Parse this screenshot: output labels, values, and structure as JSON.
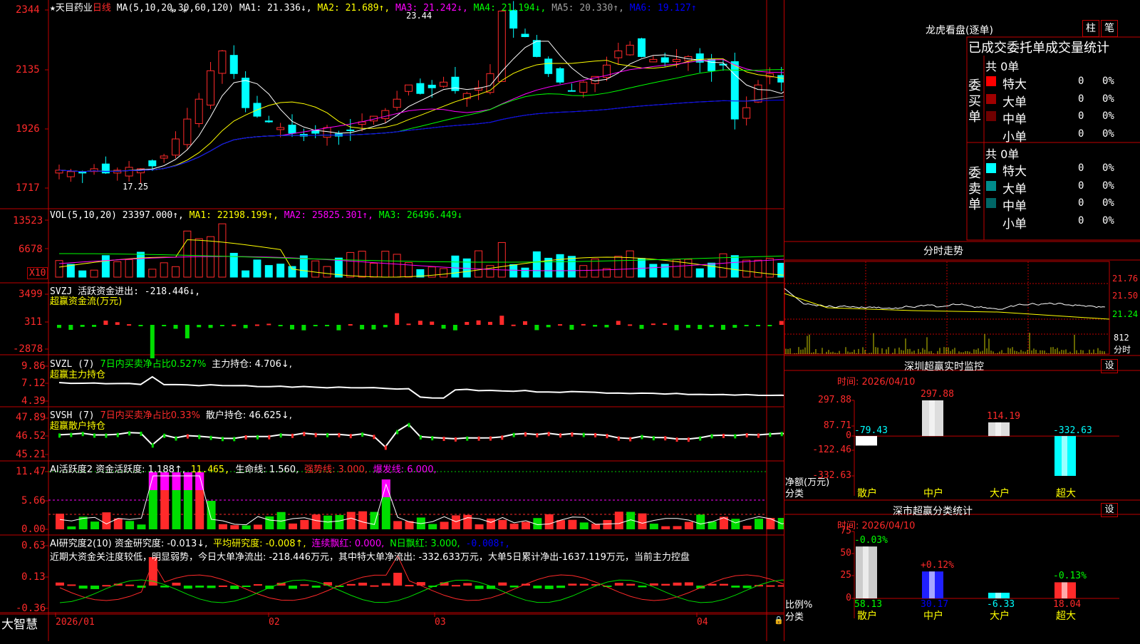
{
  "colors": {
    "up": "#ff2a2a",
    "down": "#00ffff",
    "axis": "#c00000",
    "ma1": "#ffffff",
    "ma2": "#ffff00",
    "ma3": "#ff00ff",
    "ma4": "#00ff00",
    "ma5": "#a0a0a0",
    "ma6": "#0000ff"
  },
  "main_chart": {
    "star": "★",
    "stock_name": "天目药业",
    "period": "日线",
    "ma_params": "MA(5,10,20,30,60,120)",
    "ma1": "MA1: 21.336↓,",
    "ma2": "MA2: 21.689↑,",
    "ma3": "MA3: 21.242↓,",
    "ma4": "MA4: 21.194↓,",
    "ma5": "MA5: 20.330↑,",
    "ma6": "MA6: 19.127↑",
    "marks": "* *",
    "high_label": "23.44",
    "low_label": "17.25",
    "y_ticks": [
      "2344",
      "2135",
      "1926",
      "1717"
    ]
  },
  "vol_panel": {
    "title": "VOL(5,10,20)",
    "value": "23397.000↑,",
    "ma1": "MA1: 22198.199↑,",
    "ma2": "MA2: 25825.301↑,",
    "ma3": "MA3: 26496.449↓",
    "y_ticks": [
      "13523",
      "6678"
    ],
    "unit": "X10"
  },
  "svzj_panel": {
    "title": "SVZJ  活跃资金进出: -218.446↓,",
    "subtitle": "超赢资金流(万元)",
    "y_ticks": [
      "3499",
      "311",
      "-2878"
    ]
  },
  "svzl_panel": {
    "title": "SVZL (7)",
    "ratio": "7日内买卖净占比0.527%",
    "hold": "主力持仓: 4.706↓,",
    "subtitle": "超赢主力持仓",
    "y_ticks": [
      "9.86",
      "7.12",
      "4.39"
    ]
  },
  "svsh_panel": {
    "title": "SVSH (7)",
    "ratio": "7日内买卖净占比0.33%",
    "hold": "散户持仓: 46.625↓,",
    "subtitle": "超赢散户持仓",
    "y_ticks": [
      "47.89",
      "46.52",
      "45.21"
    ]
  },
  "ai_active_panel": {
    "title": "AI活跃度2 资金活跃度: 1.188↑,",
    "v2": "11.465,",
    "life": "生命线: 1.560,",
    "strong": "强势线: 3.000,",
    "burst": "爆发线: 6.000,",
    "y_ticks": [
      "11.47",
      "5.66",
      "0.00"
    ]
  },
  "ai_research_panel": {
    "title": "AI研究度2(10) 资金研究度: -0.013↓,",
    "avg": "平均研究度: -0.008↑,",
    "red": "连续飘红: 0.000,",
    "nred": "N日飘红: 3.000,",
    "last": "-0.008↑,",
    "comment": "近期大资金关注度较低，明显弱势，今日大单净流出: -218.446万元，其中特大单净流出: -332.633万元，大单5日累计净出-1637.119万元，当前主力控盘",
    "y_ticks": [
      "0.63",
      "0.13",
      "-0.36"
    ]
  },
  "x_axis": {
    "brand": "大智慧",
    "labels": [
      "2026/01",
      "02",
      "03",
      "04"
    ]
  },
  "dragon": {
    "title": "龙虎看盘(逐单)",
    "btn1": "柱",
    "btn2": "笔",
    "tabs": "已成交委托单成交量统计",
    "buy_side": "委买单",
    "sell_side": "委卖单",
    "buy_total": "共 0单",
    "sell_total": "共 0单",
    "buy_rows": [
      {
        "label": "特大",
        "count": "0",
        "pct": "0%",
        "color": "#ff0000"
      },
      {
        "label": "大单",
        "count": "0",
        "pct": "0%",
        "color": "#a00000"
      },
      {
        "label": "中单",
        "count": "0",
        "pct": "0%",
        "color": "#700000"
      },
      {
        "label": "小单",
        "count": "0",
        "pct": "0%",
        "color": "#000000"
      }
    ],
    "sell_rows": [
      {
        "label": "特大",
        "count": "0",
        "pct": "0%",
        "color": "#00ffff"
      },
      {
        "label": "大单",
        "count": "0",
        "pct": "0%",
        "color": "#008c8c"
      },
      {
        "label": "中单",
        "count": "0",
        "pct": "0%",
        "color": "#006666"
      },
      {
        "label": "小单",
        "count": "0",
        "pct": "0%",
        "color": "#000000"
      }
    ]
  },
  "intraday": {
    "title": "分时走势",
    "y_ticks": [
      "21.76",
      "21.50",
      "21.24"
    ],
    "vol_tick": "812",
    "vol_unit": "分时"
  },
  "sz_monitor": {
    "title": "深圳超赢实时监控",
    "btn": "设",
    "time": "时间: 2026/04/10",
    "y_ticks": [
      "297.88",
      "87.71",
      "0",
      "-122.46",
      "-332.63"
    ],
    "ylabel1": "净额(万元)",
    "ylabel2": "分类",
    "categories": [
      "散户",
      "中户",
      "大户",
      "超大"
    ],
    "values": [
      -79.43,
      297.88,
      114.19,
      -332.63
    ],
    "value_labels": [
      "-79.43",
      "297.88",
      "114.19",
      "-332.63"
    ]
  },
  "sz_class": {
    "title": "深市超赢分类统计",
    "btn": "设",
    "time": "时间: 2026/04/10",
    "y_ticks": [
      "75",
      "50",
      "25",
      "0"
    ],
    "ylabel1": "比例%",
    "ylabel2": "分类",
    "categories": [
      "散户",
      "中户",
      "大户",
      "超大"
    ],
    "values": [
      58.13,
      30.17,
      -6.33,
      18.04
    ],
    "top_labels": [
      "-0.03%",
      "+0.12%",
      "",
      "-0.13%"
    ],
    "bottom_labels": [
      "58.13",
      "30.17",
      "-6.33",
      "18.04"
    ]
  },
  "chart_data": [
    {
      "type": "bar",
      "title": "深圳超赢实时监控",
      "categories": [
        "散户",
        "中户",
        "大户",
        "超大"
      ],
      "values": [
        -79.43,
        297.88,
        114.19,
        -332.63
      ],
      "ylabel": "净额(万元)",
      "ylim": [
        -332.63,
        297.88
      ]
    },
    {
      "type": "bar",
      "title": "深市超赢分类统计",
      "categories": [
        "散户",
        "中户",
        "大户",
        "超大"
      ],
      "values": [
        58.13,
        30.17,
        -6.33,
        18.04
      ],
      "ylabel": "比例%",
      "ylim": [
        0,
        75
      ]
    }
  ]
}
